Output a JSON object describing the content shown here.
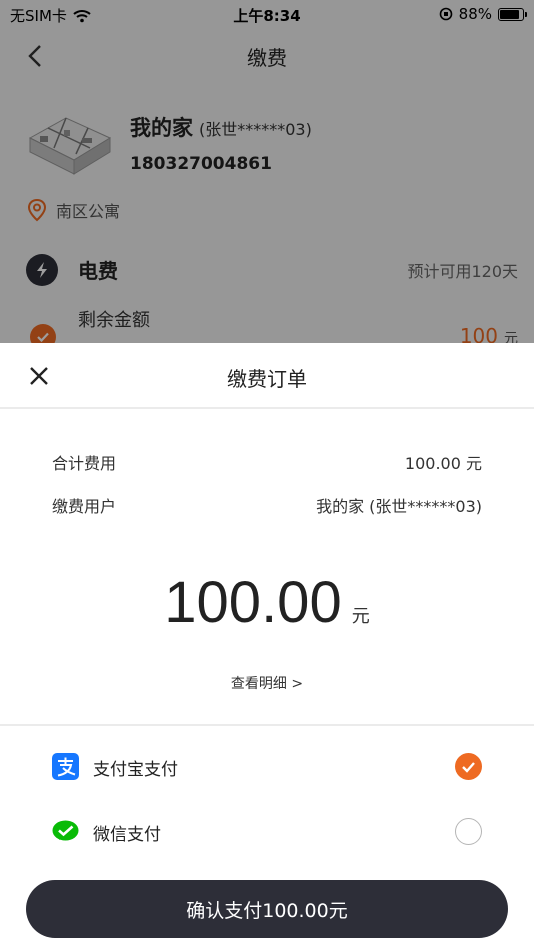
{
  "status_bar": {
    "carrier": "无SIM卡",
    "time": "上午8:34",
    "battery": "88%",
    "battery_level": 0.88
  },
  "nav": {
    "title": "缴费"
  },
  "home": {
    "name": "我的家",
    "owner": "(张世******03)",
    "phone": "180327004861"
  },
  "location": {
    "name": "南区公寓"
  },
  "electricity": {
    "title": "电费",
    "days_left": "预计可用120天"
  },
  "balance": {
    "label": "剩余金额",
    "amount": "100",
    "unit": "元"
  },
  "sheet": {
    "title": "缴费订单",
    "rows": [
      {
        "label": "合计费用",
        "value": "100.00 元"
      },
      {
        "label": "缴费用户",
        "value": "我的家 (张世******03)"
      }
    ],
    "amount": "100.00",
    "amount_unit": "元",
    "detail_link": "查看明细 >",
    "payment_methods": [
      {
        "label": "支付宝支付",
        "icon": "alipay-icon",
        "selected": true
      },
      {
        "label": "微信支付",
        "icon": "wechat-icon",
        "selected": false
      }
    ],
    "confirm_label": "确认支付100.00元"
  },
  "colors": {
    "accent": "#ee6a22",
    "dark": "#2d2e38",
    "alipay": "#1677ff",
    "wechat": "#09bb07"
  }
}
